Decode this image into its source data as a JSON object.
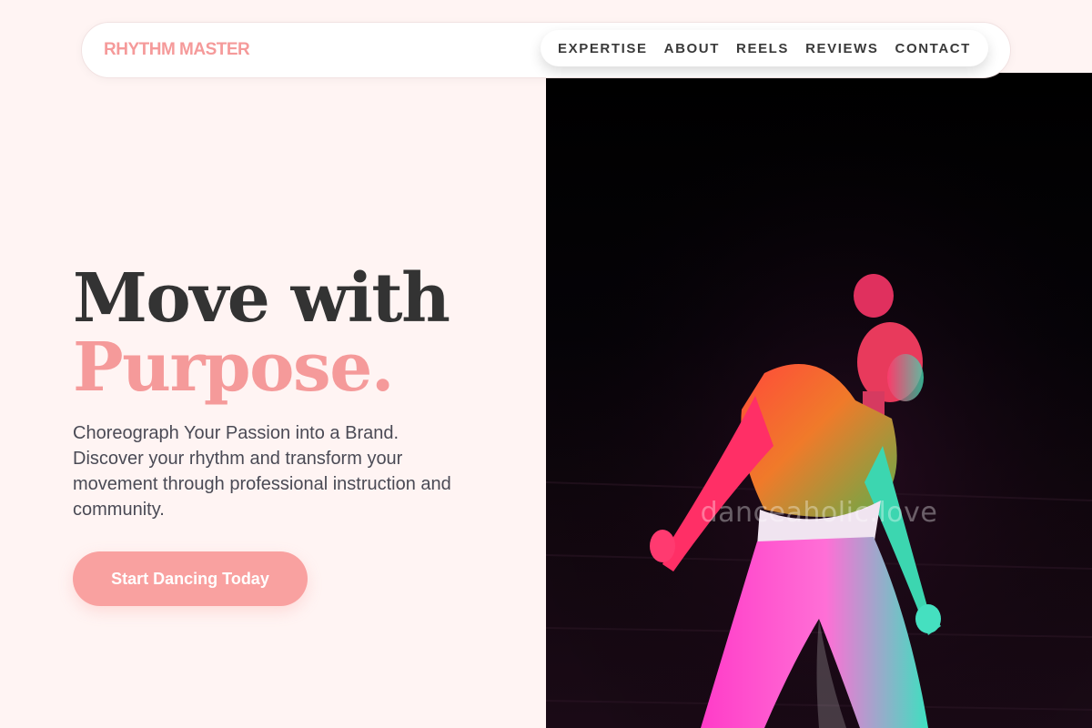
{
  "brand": {
    "name": "RHYTHM MASTER"
  },
  "nav": {
    "items": [
      {
        "label": "EXPERTISE"
      },
      {
        "label": "ABOUT"
      },
      {
        "label": "REELS"
      },
      {
        "label": "REVIEWS"
      },
      {
        "label": "CONTACT"
      }
    ]
  },
  "hero": {
    "headline_line1": "Move with",
    "headline_line2": "Purpose.",
    "subtext": "Choreograph Your Passion into a Brand. Discover your rhythm and transform your movement through professional instruction and community.",
    "cta_label": "Start Dancing Today",
    "image": {
      "subject": "dancer in colorful stage light",
      "watermark": "danceaholic.love"
    }
  },
  "colors": {
    "accent": "#f59a9a",
    "cta_bg": "#f9a1a0",
    "page_bg": "#fff4f3",
    "heading": "#333333",
    "body_text": "#4a4a55"
  }
}
